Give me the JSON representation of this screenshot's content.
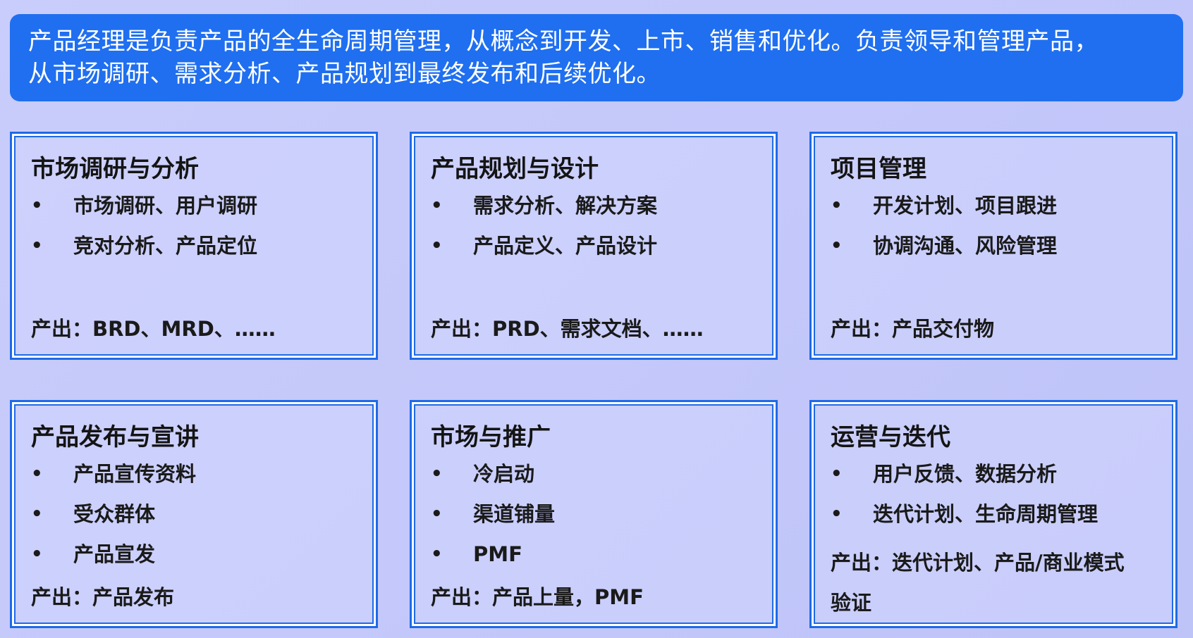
{
  "intro": {
    "line1": "产品经理是负责产品的全生命周期管理，从概念到开发、上市、销售和优化。负责领导和管理产品，",
    "line2": "从市场调研、需求分析、产品规划到最终发布和后续优化。"
  },
  "cards": [
    {
      "title": "市场调研与分析",
      "bullets": [
        "市场调研、用户调研",
        "竞对分析、产品定位"
      ],
      "output": "产出：BRD、MRD、……"
    },
    {
      "title": "产品规划与设计",
      "bullets": [
        "需求分析、解决方案",
        "产品定义、产品设计"
      ],
      "output": "产出：PRD、需求文档、……"
    },
    {
      "title": "项目管理",
      "bullets": [
        "开发计划、项目跟进",
        "协调沟通、风险管理"
      ],
      "output": "产出：产品交付物"
    },
    {
      "title": "产品发布与宣讲",
      "bullets": [
        "产品宣传资料",
        "受众群体",
        "产品宣发"
      ],
      "output": "产出：产品发布"
    },
    {
      "title": "市场与推广",
      "bullets": [
        "冷启动",
        "渠道铺量",
        "PMF"
      ],
      "output": "产出：产品上量，PMF"
    },
    {
      "title": "运营与迭代",
      "bullets": [
        "用户反馈、数据分析",
        "迭代计划、生命周期管理"
      ],
      "output_line1": "产出：迭代计划、产品/商业模式",
      "output_line2": "验证"
    }
  ],
  "bullet_symbol": "•",
  "colors": {
    "background": "#c6cafa",
    "intro_banner": "#1f6ff0",
    "card_border": "#1e6ae8"
  }
}
